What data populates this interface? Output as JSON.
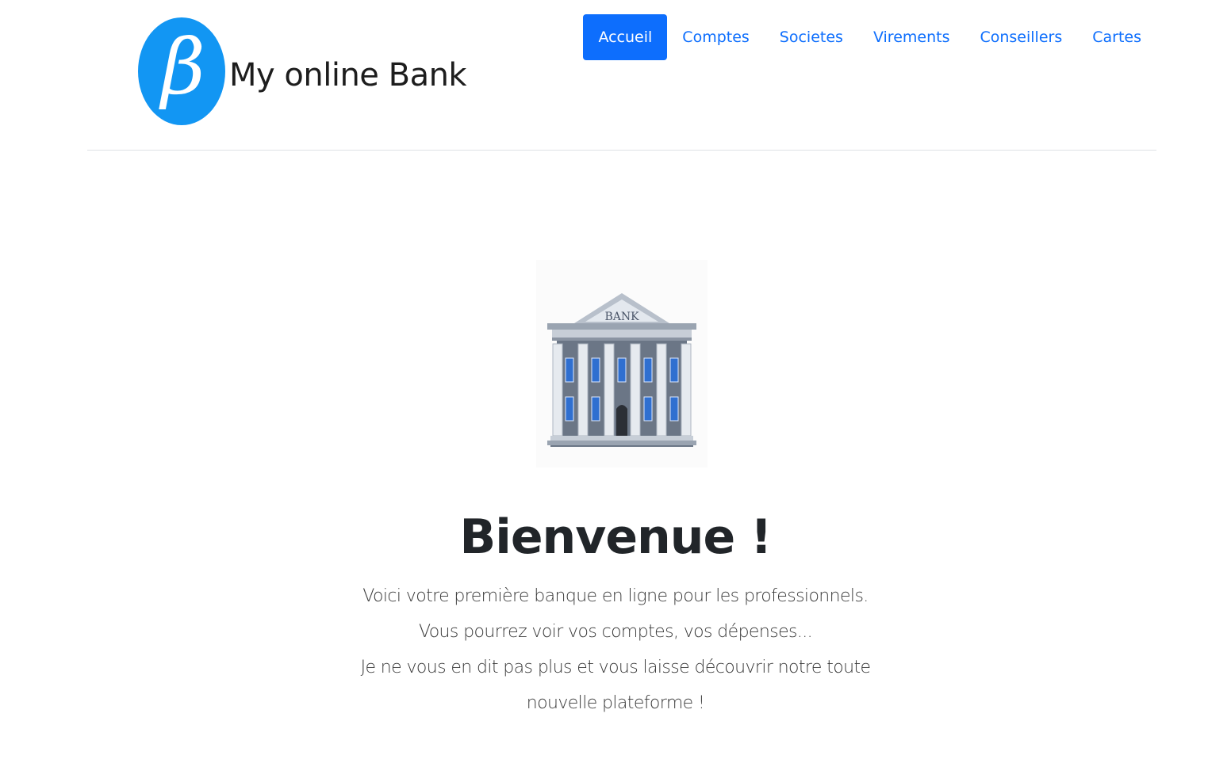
{
  "brand": {
    "name": "My online Bank",
    "logo_glyph": "β",
    "logo_color": "#1296f3"
  },
  "nav": {
    "items": [
      {
        "label": "Accueil",
        "active": true
      },
      {
        "label": "Comptes",
        "active": false
      },
      {
        "label": "Societes",
        "active": false
      },
      {
        "label": "Virements",
        "active": false
      },
      {
        "label": "Conseillers",
        "active": false
      },
      {
        "label": "Cartes",
        "active": false
      }
    ],
    "accent_color": "#0d6efd"
  },
  "hero": {
    "image_icon": "bank-building-icon",
    "image_sign": "BANK",
    "title": "Bienvenue !",
    "lead_lines": [
      "Voici votre première banque en ligne pour les professionnels.",
      "Vous pourrez voir vos comptes, vos dépenses...",
      "Je ne vous en dit pas plus et vous laisse découvrir notre toute nouvelle plateforme !"
    ]
  }
}
